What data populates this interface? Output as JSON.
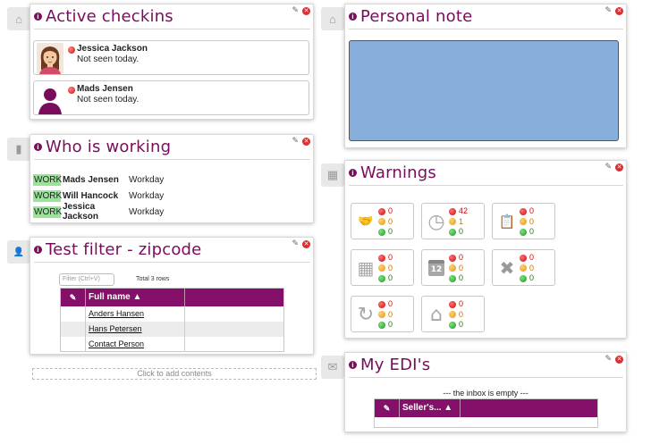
{
  "side_tabs": [
    {
      "icon": "home-icon",
      "glyph": "⌂"
    },
    {
      "icon": "book-icon",
      "glyph": "▮"
    },
    {
      "icon": "user-icon",
      "glyph": "👤"
    },
    {
      "icon": "home-icon",
      "glyph": "⌂"
    },
    {
      "icon": "building-icon",
      "glyph": "▦"
    },
    {
      "icon": "inbox-icon",
      "glyph": "✉"
    }
  ],
  "widget_controls": {
    "info_glyph": "i",
    "edit_glyph": "✎",
    "close_glyph": "✕"
  },
  "active_checkins": {
    "title": "Active checkins",
    "items": [
      {
        "name": "Jessica Jackson",
        "status": "Not seen today."
      },
      {
        "name": "Mads Jensen",
        "status": "Not seen today."
      }
    ]
  },
  "who_is_working": {
    "title": "Who is working",
    "rows": [
      {
        "badge": "WORK",
        "name": "Mads Jensen",
        "type": "Workday"
      },
      {
        "badge": "WORK",
        "name": "Will Hancock",
        "type": "Workday"
      },
      {
        "badge": "WORK",
        "name": "Jessica Jackson",
        "type": "Workday"
      }
    ]
  },
  "test_filter": {
    "title": "Test filter - zipcode",
    "filter_placeholder": "Filter (Ctrl+V)",
    "total_rows": "Total 3 rows",
    "columns": [
      "✎",
      "Full name ▲"
    ],
    "rows": [
      "Anders Hansen",
      "Hans Petersen",
      "Contact Person"
    ]
  },
  "add_contents": "Click to add contents",
  "personal_note": {
    "title": "Personal note",
    "text": ""
  },
  "warnings": {
    "title": "Warnings",
    "boxes": [
      {
        "icon": "handshake-icon",
        "glyph": "🤝",
        "red": "0",
        "orange": "0",
        "green": "0"
      },
      {
        "icon": "clock-icon",
        "glyph": "◷",
        "red": "42",
        "orange": "1",
        "green": "0"
      },
      {
        "icon": "clipboard-icon",
        "glyph": "📋",
        "red": "0",
        "orange": "0",
        "green": "0"
      },
      {
        "icon": "grid-icon",
        "glyph": "▦",
        "red": "0",
        "orange": "0",
        "green": "0"
      },
      {
        "icon": "calendar-icon",
        "glyph": "12",
        "red": "0",
        "orange": "0",
        "green": "0"
      },
      {
        "icon": "tools-icon",
        "glyph": "✖",
        "red": "0",
        "orange": "0",
        "green": "0"
      },
      {
        "icon": "refresh-icon",
        "glyph": "↻",
        "red": "0",
        "orange": "0",
        "green": "0"
      },
      {
        "icon": "house-icon",
        "glyph": "⌂",
        "red": "0",
        "orange": "0",
        "green": "0"
      }
    ]
  },
  "my_edis": {
    "title": "My EDI's",
    "empty_message": "--- the inbox is empty ---",
    "columns": [
      "✎",
      "Seller's... ▲"
    ]
  }
}
